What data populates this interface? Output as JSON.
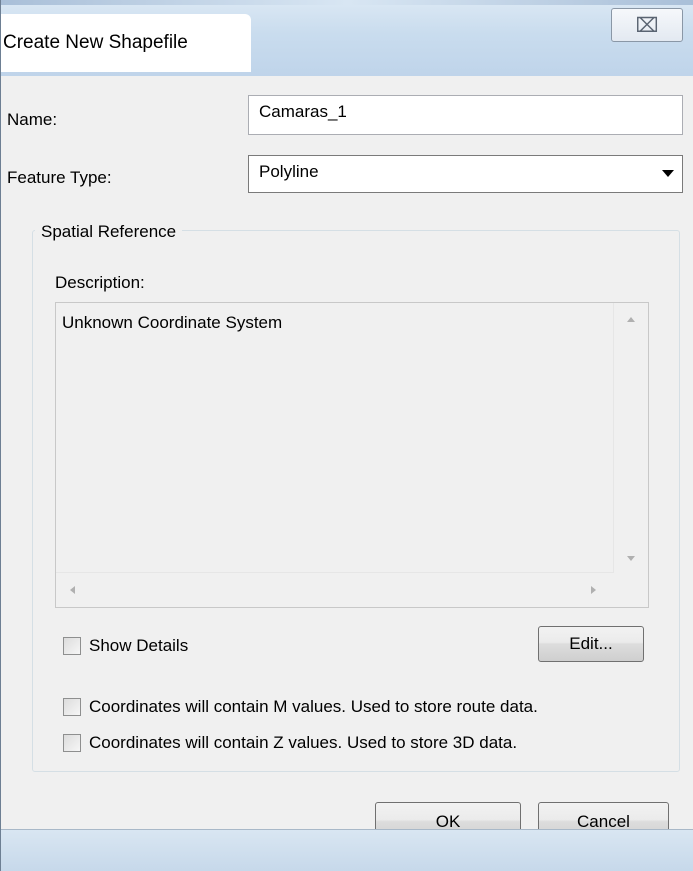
{
  "window": {
    "title": "Create New Shapefile",
    "close_glyph": "⌧",
    "icons": {
      "close": "close-icon"
    }
  },
  "form": {
    "name_label": "Name:",
    "name_value": "Camaras_1",
    "feature_type_label": "Feature Type:",
    "feature_type_value": "Polyline"
  },
  "spatial_reference": {
    "legend": "Spatial Reference",
    "description_label": "Description:",
    "description_text": "Unknown Coordinate System",
    "show_details_label": "Show Details",
    "show_details_checked": false,
    "edit_label": "Edit..."
  },
  "options": {
    "m_values_label": "Coordinates will contain M values. Used to store route data.",
    "m_values_checked": false,
    "z_values_label": "Coordinates will contain Z values. Used to store 3D data.",
    "z_values_checked": false
  },
  "buttons": {
    "ok_label": "OK",
    "cancel_label": "Cancel"
  }
}
